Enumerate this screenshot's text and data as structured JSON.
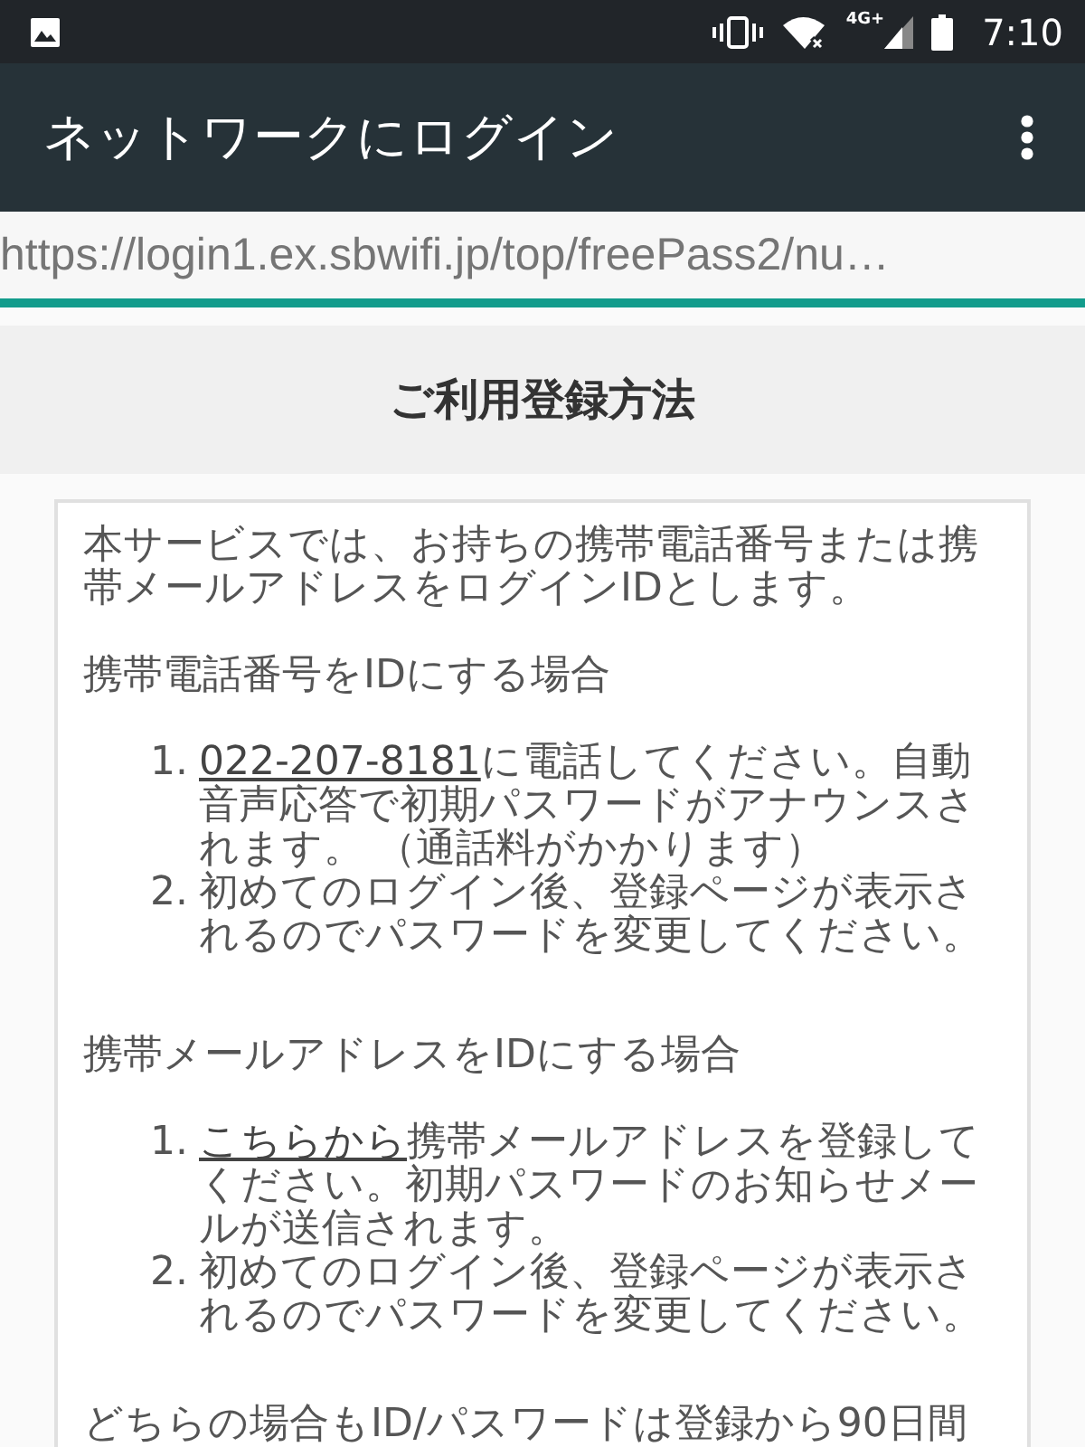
{
  "status_bar": {
    "time": "7:10",
    "network": "4G+"
  },
  "app_bar": {
    "title": "ネットワークにログイン"
  },
  "url_bar": {
    "url": "https://login1.ex.sbwifi.jp/top/freePass2/nu…"
  },
  "page": {
    "heading": "ご利用登録方法",
    "intro": "本サービスでは、お持ちの携帯電話番号または携帯メールアドレスをログインIDとします。",
    "sections": [
      {
        "title": "携帯電話番号をIDにする場合",
        "steps": [
          {
            "number": "1.",
            "link": "022-207-8181",
            "text": "に電話してください。自動音声応答で初期パスワードがアナウンスされます。 （通話料がかかります）"
          },
          {
            "number": "2.",
            "text": "初めてのログイン後、登録ページが表示されるのでパスワードを変更してください。"
          }
        ]
      },
      {
        "title": "携帯メールアドレスをIDにする場合",
        "steps": [
          {
            "number": "1.",
            "link": "こちらから",
            "text": "携帯メールアドレスを登録してください。初期パスワードのお知らせメールが送信されます。"
          },
          {
            "number": "2.",
            "text": "初めてのログイン後、登録ページが表示されるのでパスワードを変更してください。"
          }
        ]
      }
    ],
    "footer": "どちらの場合もID/パスワードは登録から90日間"
  }
}
